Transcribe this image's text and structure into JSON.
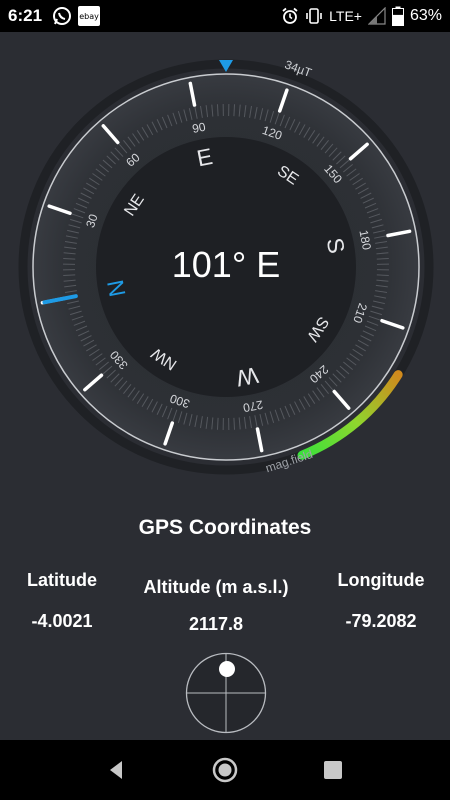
{
  "status_bar": {
    "time": "6:21",
    "notifications": [
      "whatsapp-icon",
      "ebay-icon"
    ],
    "ebay_label": "ebay",
    "network": "LTE+",
    "battery_percent": "63%",
    "battery_level": 0.63
  },
  "compass": {
    "heading_text": "101° E",
    "heading_degrees": 101,
    "cardinals": [
      "N",
      "NE",
      "E",
      "SE",
      "S",
      "SW",
      "W",
      "NW"
    ],
    "degree_labels": [
      "30",
      "60",
      "90",
      "120",
      "150",
      "180",
      "210",
      "240",
      "270",
      "300",
      "330"
    ],
    "field_strength": "34µT",
    "field_label": "mag.field",
    "accent_color": "#1e9be6",
    "field_colors": [
      "#39e13a",
      "#8fd62e",
      "#d08a1d"
    ]
  },
  "gps": {
    "title": "GPS Coordinates",
    "latitude_label": "Latitude",
    "latitude": "-4.0021",
    "altitude_label": "Altitude (m a.s.l.)",
    "altitude": "2117.8",
    "longitude_label": "Longitude",
    "longitude": "-79.2082"
  },
  "nav": {
    "buttons": [
      "back-icon",
      "home-icon",
      "recents-icon"
    ]
  }
}
